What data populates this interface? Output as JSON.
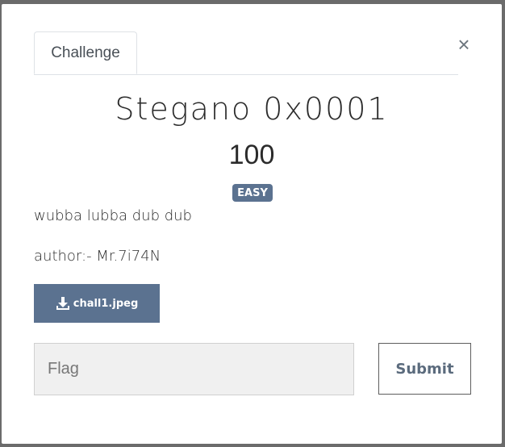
{
  "modal": {
    "tabs": [
      {
        "label": "Challenge"
      }
    ],
    "close_symbol": "×"
  },
  "challenge": {
    "name": "Stegano 0x0001",
    "points": "100",
    "difficulty": "EASY",
    "description_lines": [
      "wubba lubba dub dub",
      "author:- Mr.7i74N"
    ],
    "files": [
      {
        "name": "chall1.jpeg",
        "icon": "download-icon"
      }
    ]
  },
  "submission": {
    "flag_placeholder": "Flag",
    "flag_value": "",
    "submit_label": "Submit"
  },
  "colors": {
    "accent": "#5b7290",
    "input_bg": "#f0f0f0",
    "text": "#2b2b2b"
  }
}
